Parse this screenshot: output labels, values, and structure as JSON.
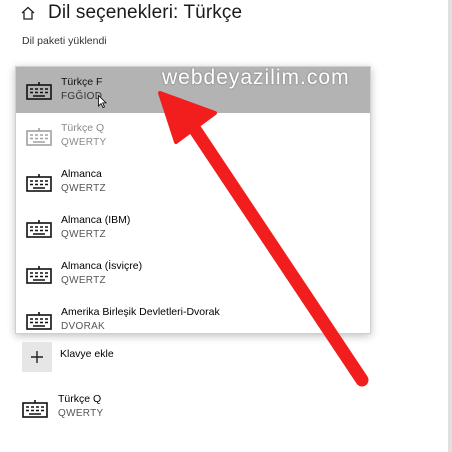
{
  "header": {
    "title": "Dil seçenekleri: Türkçe",
    "home_icon": "home-icon"
  },
  "status": {
    "subtitle": "Dil paketi yüklendi"
  },
  "keyboard_list": {
    "items": [
      {
        "name": "Türkçe F",
        "layout": "FGĞIOD",
        "state": "selected"
      },
      {
        "name": "Türkçe Q",
        "layout": "QWERTY",
        "state": "disabled"
      },
      {
        "name": "Almanca",
        "layout": "QWERTZ",
        "state": "normal"
      },
      {
        "name": "Almanca (IBM)",
        "layout": "QWERTZ",
        "state": "normal"
      },
      {
        "name": "Almanca (İsviçre)",
        "layout": "QWERTZ",
        "state": "normal"
      },
      {
        "name": "Amerika Birleşik Devletleri-Dvorak",
        "layout": "DVORAK",
        "state": "normal"
      }
    ]
  },
  "watermark": {
    "text": "webdeyazilim.com"
  },
  "add_keyboard": {
    "label": "Klavye ekle",
    "icon": "plus-icon"
  },
  "installed_keyboard": {
    "name": "Türkçe Q",
    "layout": "QWERTY",
    "icon": "keyboard-icon"
  },
  "colors": {
    "selected_bg": "#b3b3b3",
    "arrow": "#f21d1d",
    "add_button_bg": "#e6e6e6"
  }
}
